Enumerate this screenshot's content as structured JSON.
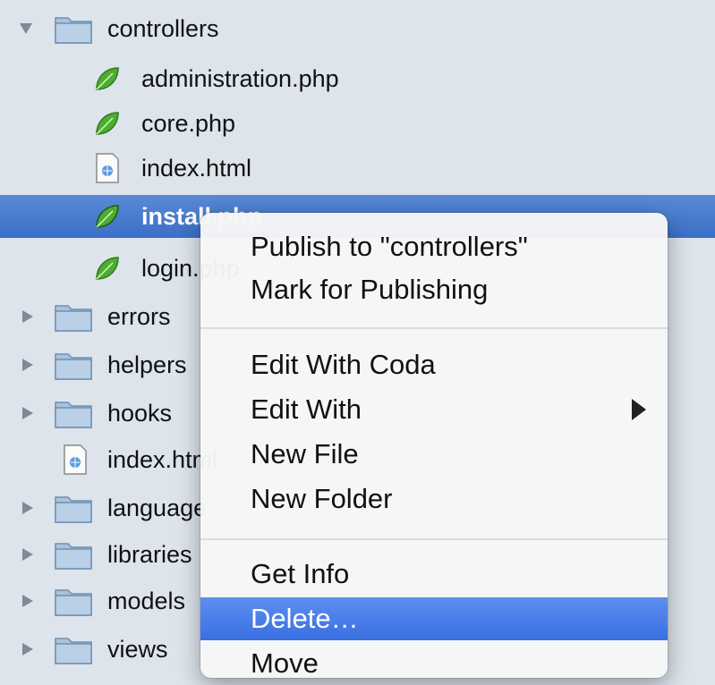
{
  "tree": {
    "items": [
      {
        "label": "controllers",
        "kind": "folder",
        "expanded": true
      },
      {
        "label": "administration.php",
        "kind": "php"
      },
      {
        "label": "core.php",
        "kind": "php"
      },
      {
        "label": "index.html",
        "kind": "html"
      },
      {
        "label": "install.php",
        "kind": "php",
        "selected": true
      },
      {
        "label": "login.php",
        "kind": "php"
      },
      {
        "label": "errors",
        "kind": "folder"
      },
      {
        "label": "helpers",
        "kind": "folder"
      },
      {
        "label": "hooks",
        "kind": "folder"
      },
      {
        "label": "index.html",
        "kind": "html"
      },
      {
        "label": "language",
        "kind": "folder"
      },
      {
        "label": "libraries",
        "kind": "folder"
      },
      {
        "label": "models",
        "kind": "folder"
      },
      {
        "label": "views",
        "kind": "folder"
      }
    ]
  },
  "context_menu": {
    "publish": "Publish to \"controllers\"",
    "mark_publishing": "Mark for Publishing",
    "edit_with_coda": "Edit With Coda",
    "edit_with": "Edit With",
    "new_file": "New File",
    "new_folder": "New Folder",
    "get_info": "Get Info",
    "delete": "Delete…",
    "move": "Move"
  },
  "colors": {
    "sidebar_bg": "#dde4ec",
    "selection": "#3b6fc7",
    "menu_highlight": "#3a6fe2",
    "folder": "#a9c3dd",
    "php_leaf": "#4cae2f"
  }
}
